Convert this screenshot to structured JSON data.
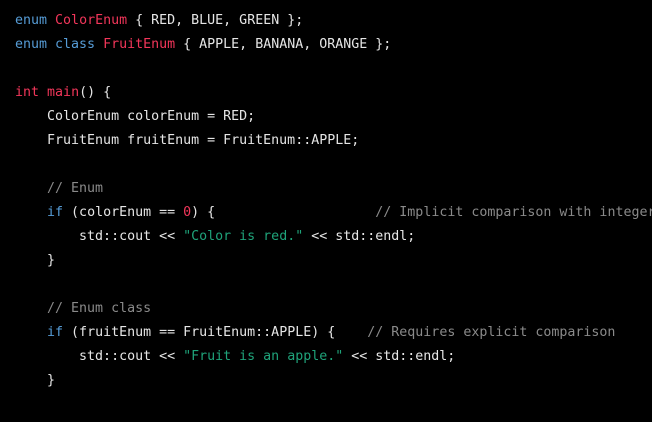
{
  "colors": {
    "background": "#000000",
    "plain": "#e6e6e6",
    "keyword": "#569cd6",
    "type_name": "#f2365a",
    "number": "#f2365a",
    "string": "#1fa37a",
    "comment": "#8a8a8a"
  },
  "code": {
    "language": "cpp",
    "lines": [
      [
        {
          "t": "enum",
          "k": "keyword"
        },
        {
          "t": " ",
          "k": "plain"
        },
        {
          "t": "ColorEnum",
          "k": "type_name"
        },
        {
          "t": " { RED, BLUE, GREEN };",
          "k": "plain"
        }
      ],
      [
        {
          "t": "enum class",
          "k": "keyword"
        },
        {
          "t": " ",
          "k": "plain"
        },
        {
          "t": "FruitEnum",
          "k": "type_name"
        },
        {
          "t": " { APPLE, BANANA, ORANGE };",
          "k": "plain"
        }
      ],
      [],
      [
        {
          "t": "int",
          "k": "type_name"
        },
        {
          "t": " ",
          "k": "plain"
        },
        {
          "t": "main",
          "k": "type_name"
        },
        {
          "t": "() {",
          "k": "plain"
        }
      ],
      [
        {
          "t": "    ColorEnum colorEnum = RED;",
          "k": "plain"
        }
      ],
      [
        {
          "t": "    FruitEnum fruitEnum = FruitEnum::APPLE;",
          "k": "plain"
        }
      ],
      [],
      [
        {
          "t": "    // Enum",
          "k": "comment"
        }
      ],
      [
        {
          "t": "    ",
          "k": "plain"
        },
        {
          "t": "if",
          "k": "keyword"
        },
        {
          "t": " (colorEnum == ",
          "k": "plain"
        },
        {
          "t": "0",
          "k": "number"
        },
        {
          "t": ") {                    ",
          "k": "plain"
        },
        {
          "t": "// Implicit comparison with integer",
          "k": "comment"
        }
      ],
      [
        {
          "t": "        std::cout << ",
          "k": "plain"
        },
        {
          "t": "\"Color is red.\"",
          "k": "string"
        },
        {
          "t": " << std::endl;",
          "k": "plain"
        }
      ],
      [
        {
          "t": "    }",
          "k": "plain"
        }
      ],
      [],
      [
        {
          "t": "    // Enum class",
          "k": "comment"
        }
      ],
      [
        {
          "t": "    ",
          "k": "plain"
        },
        {
          "t": "if",
          "k": "keyword"
        },
        {
          "t": " (fruitEnum == FruitEnum::APPLE) {    ",
          "k": "plain"
        },
        {
          "t": "// Requires explicit comparison",
          "k": "comment"
        }
      ],
      [
        {
          "t": "        std::cout << ",
          "k": "plain"
        },
        {
          "t": "\"Fruit is an apple.\"",
          "k": "string"
        },
        {
          "t": " << std::endl;",
          "k": "plain"
        }
      ],
      [
        {
          "t": "    }",
          "k": "plain"
        }
      ]
    ]
  }
}
